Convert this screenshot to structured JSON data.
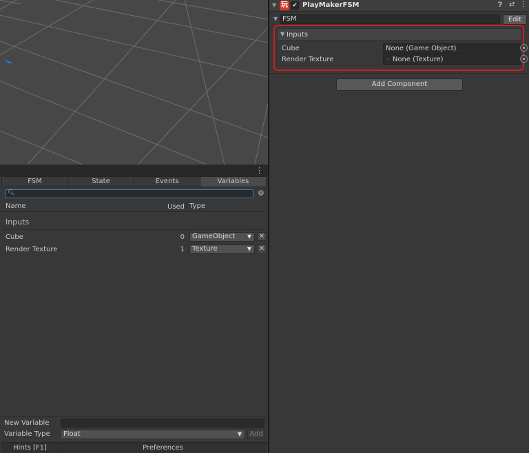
{
  "scene": {
    "gizmo_color": "#2f6fe0"
  },
  "playmaker": {
    "tabs": [
      {
        "label": "FSM"
      },
      {
        "label": "State"
      },
      {
        "label": "Events"
      },
      {
        "label": "Variables"
      }
    ],
    "active_tab": "Variables",
    "search": {
      "value": "",
      "placeholder": ""
    },
    "columns": {
      "name": "Name",
      "used": "Used",
      "type": "Type"
    },
    "section_title": "Inputs",
    "variables": [
      {
        "name": "Cube",
        "used": "0",
        "type": "GameObject"
      },
      {
        "name": "Render Texture",
        "used": "1",
        "type": "Texture"
      }
    ],
    "new_variable": {
      "label": "New Variable",
      "value": "",
      "type_label": "Variable Type",
      "type_value": "Float",
      "add_label": "Add"
    },
    "footer": {
      "hints": "Hints [F1]",
      "preferences": "Preferences"
    }
  },
  "inspector": {
    "component_title": "PlayMakerFSM",
    "logo_glyph": "玩",
    "enabled": true,
    "fsm_name": "FSM",
    "edit_label": "Edit",
    "inputs": {
      "title": "Inputs",
      "rows": [
        {
          "label": "Cube",
          "value": "None (Game Object)",
          "icon": ""
        },
        {
          "label": "Render Texture",
          "value": "None (Texture)",
          "icon": "texture-icon"
        }
      ]
    },
    "add_component_label": "Add Component",
    "highlight_color": "#d11c1c"
  }
}
